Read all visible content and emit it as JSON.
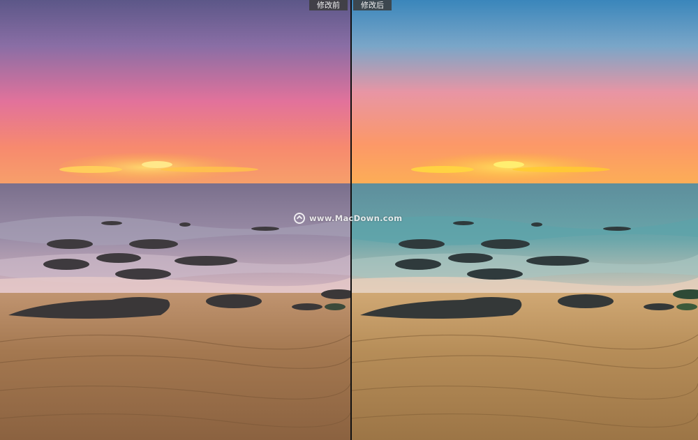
{
  "labels": {
    "before": "修改前",
    "after": "修改后"
  },
  "watermark": {
    "text": "www.MacDown.com"
  },
  "colors": {
    "before_sky_top": "#6b5a8a",
    "before_sky_mid": "#e0708e",
    "before_horizon": "#ff9c5a",
    "after_sky_top": "#3f7fb3",
    "after_sky_mid": "#ee9aa0",
    "after_horizon": "#ffb640",
    "sand": "#a87a4e"
  }
}
